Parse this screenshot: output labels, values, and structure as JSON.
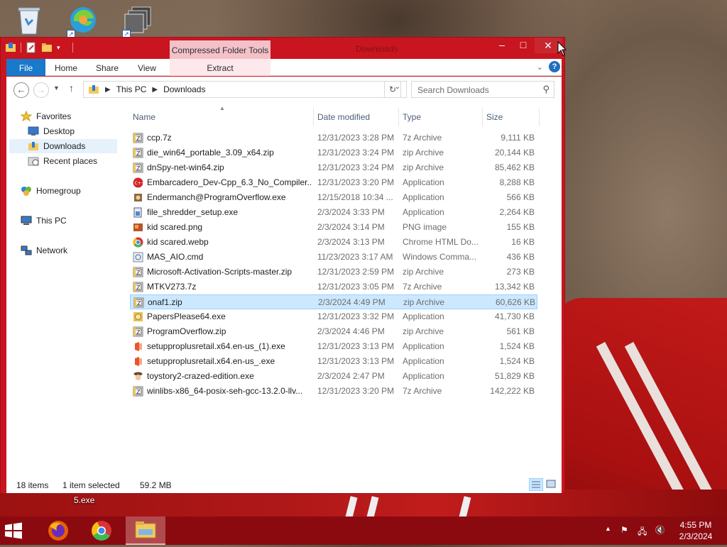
{
  "window": {
    "context_tab": "Compressed Folder Tools",
    "title": "Downloads",
    "close_glyph": "✕"
  },
  "ribbon": {
    "tabs": [
      "File",
      "Home",
      "Share",
      "View",
      "Extract"
    ]
  },
  "address": {
    "crumbs": [
      "This PC",
      "Downloads"
    ],
    "search_placeholder": "Search Downloads"
  },
  "nav": {
    "favorites": "Favorites",
    "desktop": "Desktop",
    "downloads": "Downloads",
    "recent": "Recent places",
    "homegroup": "Homegroup",
    "thispc": "This PC",
    "network": "Network"
  },
  "columns": [
    "Name",
    "Date modified",
    "Type",
    "Size"
  ],
  "files": [
    {
      "name": "ccp.7z",
      "date": "12/31/2023 3:28 PM",
      "type": "7z Archive",
      "size": "9,111 KB",
      "icon": "archive-icon"
    },
    {
      "name": "die_win64_portable_3.09_x64.zip",
      "date": "12/31/2023 3:24 PM",
      "type": "zip Archive",
      "size": "20,144 KB",
      "icon": "archive-icon"
    },
    {
      "name": "dnSpy-net-win64.zip",
      "date": "12/31/2023 3:24 PM",
      "type": "zip Archive",
      "size": "85,462 KB",
      "icon": "archive-icon"
    },
    {
      "name": "Embarcadero_Dev-Cpp_6.3_No_Compiler...",
      "date": "12/31/2023 3:20 PM",
      "type": "Application",
      "size": "8,288 KB",
      "icon": "devcpp-icon"
    },
    {
      "name": "Endermanch@ProgramOverflow.exe",
      "date": "12/15/2018 10:34 ...",
      "type": "Application",
      "size": "566 KB",
      "icon": "app-icon"
    },
    {
      "name": "file_shredder_setup.exe",
      "date": "2/3/2024 3:33 PM",
      "type": "Application",
      "size": "2,264 KB",
      "icon": "setup-icon"
    },
    {
      "name": "kid scared.png",
      "date": "2/3/2024 3:14 PM",
      "type": "PNG image",
      "size": "155 KB",
      "icon": "image-icon"
    },
    {
      "name": "kid scared.webp",
      "date": "2/3/2024 3:13 PM",
      "type": "Chrome HTML Do...",
      "size": "16 KB",
      "icon": "chrome-icon"
    },
    {
      "name": "MAS_AIO.cmd",
      "date": "11/23/2023 3:17 AM",
      "type": "Windows Comma...",
      "size": "436 KB",
      "icon": "cmd-icon"
    },
    {
      "name": "Microsoft-Activation-Scripts-master.zip",
      "date": "12/31/2023 2:59 PM",
      "type": "zip Archive",
      "size": "273 KB",
      "icon": "archive-icon"
    },
    {
      "name": "MTKV273.7z",
      "date": "12/31/2023 3:05 PM",
      "type": "7z Archive",
      "size": "13,342 KB",
      "icon": "archive-icon"
    },
    {
      "name": "onaf1.zip",
      "date": "2/3/2024 4:49 PM",
      "type": "zip Archive",
      "size": "60,626 KB",
      "icon": "archive-icon",
      "selected": true
    },
    {
      "name": "PapersPlease64.exe",
      "date": "12/31/2023 3:32 PM",
      "type": "Application",
      "size": "41,730 KB",
      "icon": "papers-icon"
    },
    {
      "name": "ProgramOverflow.zip",
      "date": "2/3/2024 4:46 PM",
      "type": "zip Archive",
      "size": "561 KB",
      "icon": "archive-icon"
    },
    {
      "name": "setupproplusretail.x64.en-us_(1).exe",
      "date": "12/31/2023 3:13 PM",
      "type": "Application",
      "size": "1,524 KB",
      "icon": "office-icon"
    },
    {
      "name": "setupproplusretail.x64.en-us_.exe",
      "date": "12/31/2023 3:13 PM",
      "type": "Application",
      "size": "1,524 KB",
      "icon": "office-icon"
    },
    {
      "name": "toystory2-crazed-edition.exe",
      "date": "2/3/2024 2:47 PM",
      "type": "Application",
      "size": "51,829 KB",
      "icon": "toystory-icon"
    },
    {
      "name": "winlibs-x86_64-posix-seh-gcc-13.2.0-llv...",
      "date": "12/31/2023 3:20 PM",
      "type": "7z Archive",
      "size": "142,222 KB",
      "icon": "archive-icon"
    }
  ],
  "status": {
    "items": "18 items",
    "selected": "1 item selected",
    "size": "59.2 MB"
  },
  "desktop_label": "5.exe",
  "clock": {
    "time": "4:55 PM",
    "date": "2/3/2024"
  },
  "colors": {
    "window_frame": "#c9151f",
    "ribbon_file": "#1979ca",
    "selection": "#cce8ff",
    "taskbar": "#8a0a10"
  }
}
